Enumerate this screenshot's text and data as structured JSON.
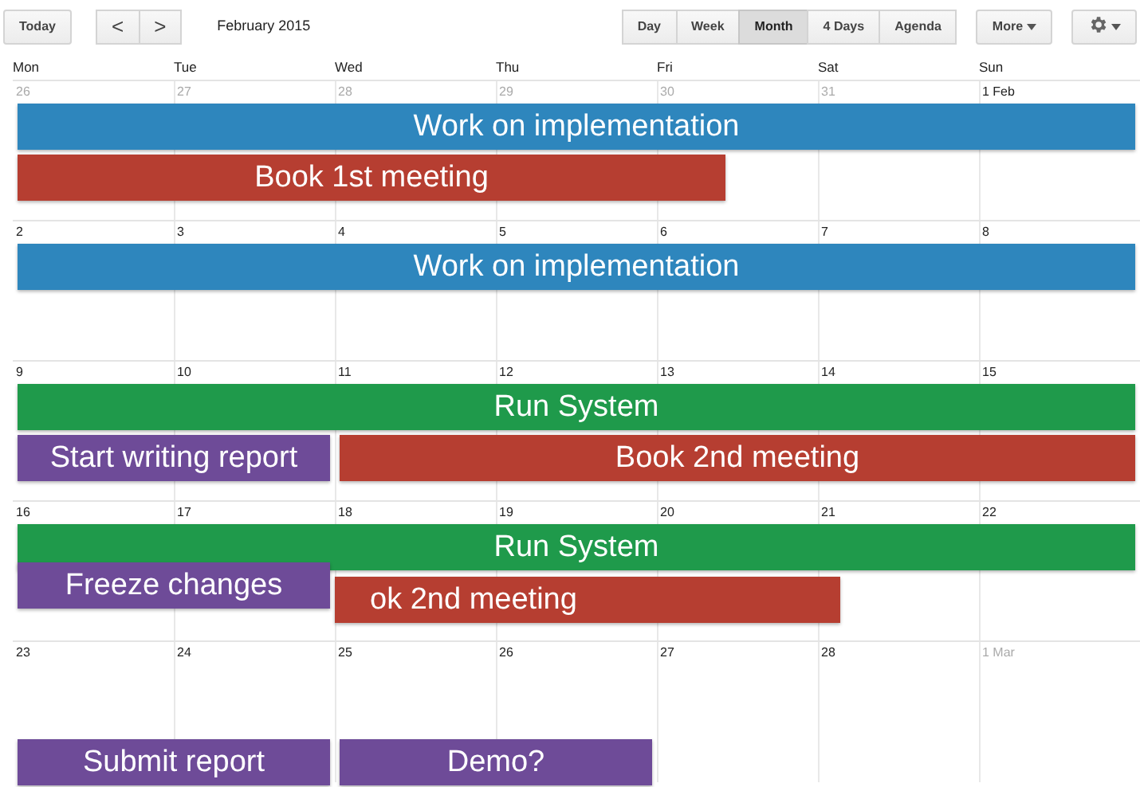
{
  "toolbar": {
    "today": "Today",
    "prev": "<",
    "next": ">",
    "title": "February 2015",
    "views": [
      {
        "label": "Day",
        "selected": false
      },
      {
        "label": "Week",
        "selected": false
      },
      {
        "label": "Month",
        "selected": true
      },
      {
        "label": "4 Days",
        "selected": false
      },
      {
        "label": "Agenda",
        "selected": false
      }
    ],
    "more": "More"
  },
  "weekdays": [
    "Mon",
    "Tue",
    "Wed",
    "Thu",
    "Fri",
    "Sat",
    "Sun"
  ],
  "weeks": [
    {
      "days": [
        {
          "label": "26",
          "other_month": true
        },
        {
          "label": "27",
          "other_month": true
        },
        {
          "label": "28",
          "other_month": true
        },
        {
          "label": "29",
          "other_month": true
        },
        {
          "label": "30",
          "other_month": true
        },
        {
          "label": "31",
          "other_month": true
        },
        {
          "label": "1 Feb",
          "other_month": false
        }
      ],
      "events": [
        {
          "title": "Work on implementation",
          "color": "#2e86bd"
        },
        {
          "title": "Book 1st meeting",
          "color": "#b63e31"
        }
      ]
    },
    {
      "days": [
        {
          "label": "2",
          "other_month": false
        },
        {
          "label": "3",
          "other_month": false
        },
        {
          "label": "4",
          "other_month": false
        },
        {
          "label": "5",
          "other_month": false
        },
        {
          "label": "6",
          "other_month": false
        },
        {
          "label": "7",
          "other_month": false
        },
        {
          "label": "8",
          "other_month": false
        }
      ],
      "events": [
        {
          "title": "Work on implementation",
          "color": "#2e86bd"
        }
      ]
    },
    {
      "days": [
        {
          "label": "9",
          "other_month": false
        },
        {
          "label": "10",
          "other_month": false
        },
        {
          "label": "11",
          "other_month": false
        },
        {
          "label": "12",
          "other_month": false
        },
        {
          "label": "13",
          "other_month": false
        },
        {
          "label": "14",
          "other_month": false
        },
        {
          "label": "15",
          "other_month": false
        }
      ],
      "events": [
        {
          "title": "Run System",
          "color": "#1f9a4b"
        },
        {
          "title": "Start writing report",
          "color": "#6e4b98"
        },
        {
          "title": "Book 2nd meeting",
          "color": "#b63e31"
        }
      ]
    },
    {
      "days": [
        {
          "label": "16",
          "other_month": false
        },
        {
          "label": "17",
          "other_month": false
        },
        {
          "label": "18",
          "other_month": false
        },
        {
          "label": "19",
          "other_month": false
        },
        {
          "label": "20",
          "other_month": false
        },
        {
          "label": "21",
          "other_month": false
        },
        {
          "label": "22",
          "other_month": false
        }
      ],
      "events": [
        {
          "title": "Run System",
          "color": "#1f9a4b"
        },
        {
          "title": "Freeze changes",
          "color": "#6e4b98"
        },
        {
          "title": "ok 2nd meeting",
          "color": "#b63e31"
        }
      ]
    },
    {
      "days": [
        {
          "label": "23",
          "other_month": false
        },
        {
          "label": "24",
          "other_month": false
        },
        {
          "label": "25",
          "other_month": false
        },
        {
          "label": "26",
          "other_month": false
        },
        {
          "label": "27",
          "other_month": false
        },
        {
          "label": "28",
          "other_month": false
        },
        {
          "label": "1 Mar",
          "other_month": true
        }
      ],
      "events": [
        {
          "title": "Submit report",
          "color": "#6e4b98"
        },
        {
          "title": "Demo?",
          "color": "#6e4b98"
        }
      ]
    }
  ]
}
